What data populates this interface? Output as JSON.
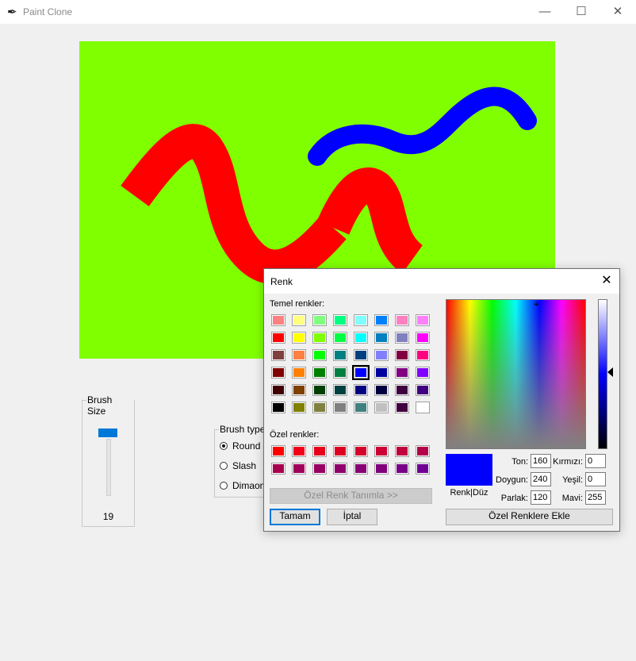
{
  "window": {
    "title": "Paint Clone",
    "icon": "feather-icon"
  },
  "canvas": {
    "background": "#80ff00",
    "strokes": [
      {
        "color": "#ff0000",
        "name": "red-stroke-1"
      },
      {
        "color": "#ff0000",
        "name": "red-stroke-2"
      },
      {
        "color": "#0000ff",
        "name": "blue-stroke"
      }
    ]
  },
  "brush_size": {
    "label": "Brush Size",
    "value": "19"
  },
  "brush_type": {
    "label": "Brush type",
    "options": [
      {
        "label": "Round",
        "checked": true
      },
      {
        "label": "Slash",
        "checked": false
      },
      {
        "label": "Dimaon",
        "checked": false
      }
    ]
  },
  "color_dialog": {
    "title": "Renk",
    "basic_label": "Temel renkler:",
    "basic_colors": [
      [
        "#ff8080",
        "#ffff80",
        "#80ff80",
        "#00ff80",
        "#80ffff",
        "#0080ff",
        "#ff80c0",
        "#ff80ff"
      ],
      [
        "#ff0000",
        "#ffff00",
        "#80ff00",
        "#00ff40",
        "#00ffff",
        "#0080c0",
        "#8080c0",
        "#ff00ff"
      ],
      [
        "#804040",
        "#ff8040",
        "#00ff00",
        "#008080",
        "#004080",
        "#8080ff",
        "#800040",
        "#ff0080"
      ],
      [
        "#800000",
        "#ff8000",
        "#008000",
        "#008040",
        "#0000ff",
        "#0000a0",
        "#800080",
        "#8000ff"
      ],
      [
        "#400000",
        "#804000",
        "#004000",
        "#004040",
        "#000080",
        "#000040",
        "#400040",
        "#400080"
      ],
      [
        "#000000",
        "#808000",
        "#808040",
        "#808080",
        "#408080",
        "#c0c0c0",
        "#400040",
        "#ffffff"
      ]
    ],
    "selected_basic": [
      3,
      4
    ],
    "custom_label": "Özel renkler:",
    "custom_colors": [
      [
        "#ff0000",
        "#f20018",
        "#e6001a",
        "#dd0020",
        "#d4002a",
        "#cc0033",
        "#c0003c",
        "#b40048"
      ],
      [
        "#a80050",
        "#a0005a",
        "#980064",
        "#90006c",
        "#880074",
        "#80007c",
        "#780088",
        "#700094"
      ]
    ],
    "define_custom_button": "Özel Renk Tanımla >>",
    "ok_button": "Tamam",
    "cancel_button": "İptal",
    "preview_label": "Renk|Düz",
    "preview_color": "#0000ff",
    "fields": {
      "hue_label": "Ton:",
      "hue": "160",
      "sat_label": "Doygun:",
      "sat": "240",
      "lum_label": "Parlak:",
      "lum": "120",
      "red_label": "Kırmızı:",
      "red": "0",
      "green_label": "Yeşil:",
      "green": "0",
      "blue_label": "Mavi:",
      "blue": "255"
    },
    "add_custom_button": "Özel Renklere Ekle"
  }
}
